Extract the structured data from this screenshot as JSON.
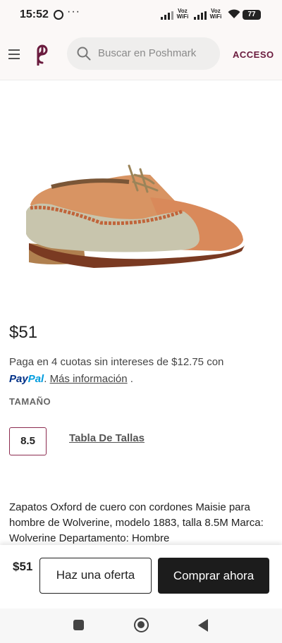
{
  "status_bar": {
    "time": "15:52",
    "whatsapp_icon": "whatsapp-icon",
    "more": "···",
    "volte1": "Voz\nWiFi",
    "volte2": "Voz\nWiFi",
    "battery": "77"
  },
  "header": {
    "menu_icon": "hamburger-menu-icon",
    "logo_icon": "poshmark-logo-icon",
    "search_placeholder": "Buscar en Poshmark",
    "login_label": "ACCESO",
    "brand_color": "#6a1b3e"
  },
  "product": {
    "image_alt": "shoe-photo",
    "price": "$51",
    "installments_text": "Paga en 4 cuotas sin intereses de $12.75 con",
    "paypal_part1": "Pay",
    "paypal_part2": "Pal",
    "more_info": "Más información",
    "more_info_suffix": " .",
    "size_title": "TAMAÑO",
    "size_value": "8.5",
    "size_chart_link": "Tabla De Tallas",
    "description": "Zapatos Oxford de cuero con cordones Maisie para hombre de Wolverine, modelo 1883, talla 8.5M Marca: Wolverine Departamento: Hombre"
  },
  "action_bar": {
    "price": "$51",
    "offer_label": "Haz una oferta",
    "buy_label": "Comprar ahora"
  },
  "nav": {
    "recent_icon": "recent-apps-icon",
    "home_icon": "home-icon",
    "back_icon": "back-icon"
  }
}
